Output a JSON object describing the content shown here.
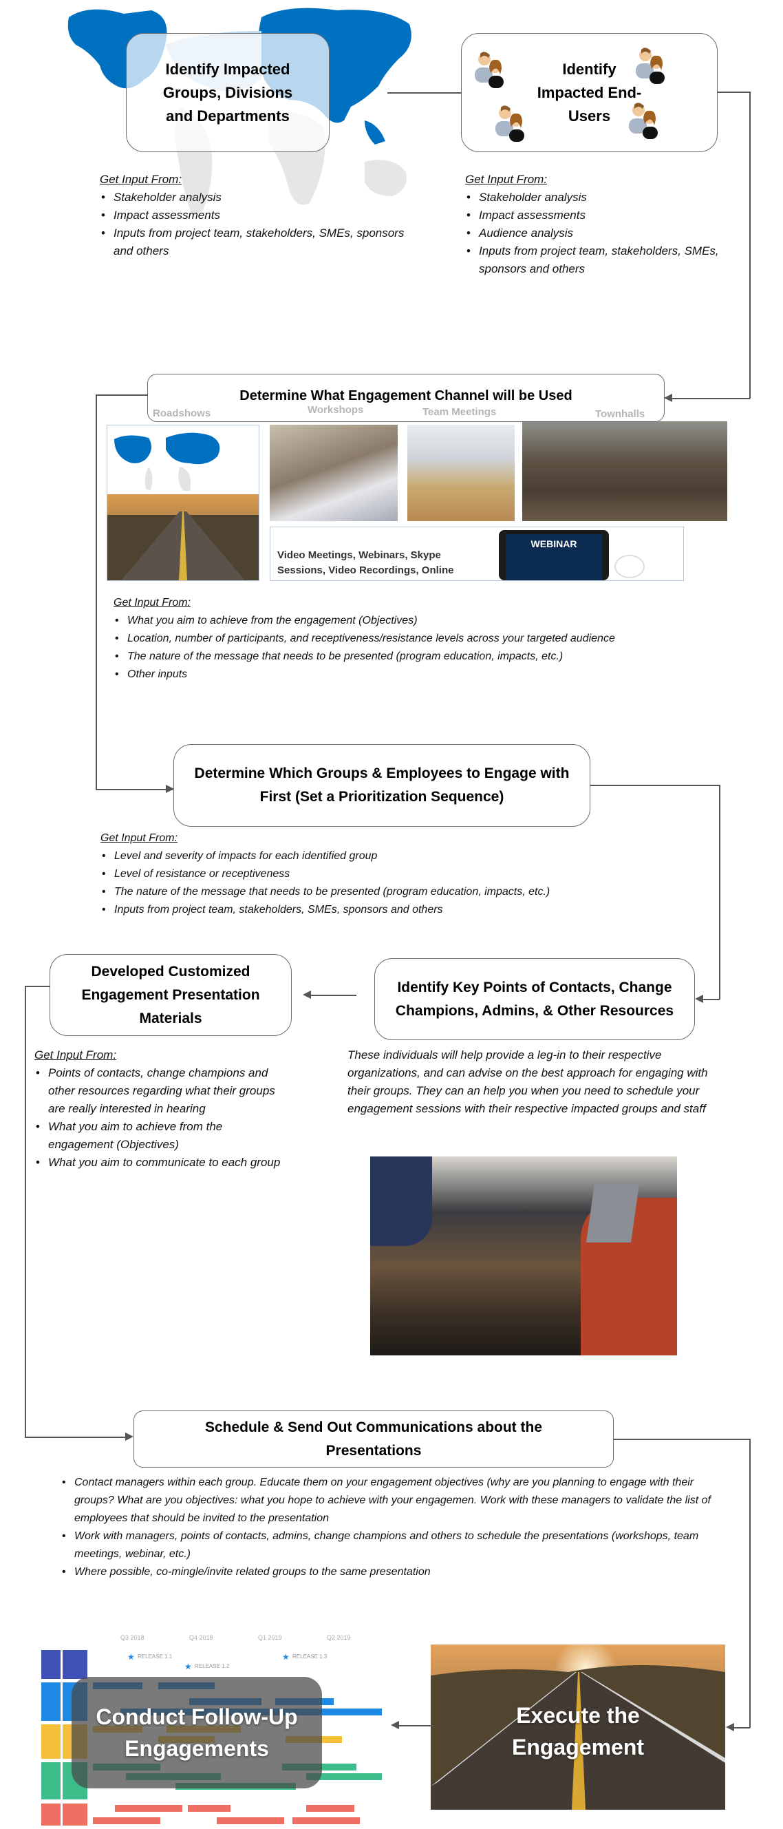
{
  "common": {
    "get_input_from": "Get Input From:"
  },
  "step1": {
    "title": "Identify Impacted Groups, Divisions and Departments",
    "inputs": [
      "Stakeholder analysis",
      "Impact assessments",
      "Inputs from project team, stakeholders, SMEs, sponsors and others"
    ]
  },
  "step2": {
    "title": "Identify Impacted End-Users",
    "inputs": [
      "Stakeholder analysis",
      "Impact assessments",
      "Audience analysis",
      "Inputs from project team, stakeholders, SMEs, sponsors and others"
    ]
  },
  "step3": {
    "title": "Determine What Engagement Channel will be Used",
    "channels": [
      "Roadshows",
      "Workshops",
      "Team Meetings",
      "Townhalls"
    ],
    "virtual_caption": "Video Meetings, Webinars, Skype Sessions, Video Recordings, Online",
    "webinar_label": "WEBINAR",
    "inputs": [
      "What you aim to achieve from the engagement (Objectives)",
      "Location, number of participants,  and receptiveness/resistance  levels across your targeted audience",
      "The nature of the message that needs to be presented (program education, impacts, etc.)",
      "Other inputs"
    ]
  },
  "step4": {
    "title": "Determine Which Groups & Employees to Engage with First (Set a Prioritization Sequence)",
    "inputs": [
      "Level and severity of impacts for each identified group",
      "Level of resistance or receptiveness",
      "The nature of the message that needs to be presented (program education, impacts, etc.)",
      "Inputs from project team, stakeholders, SMEs, sponsors and others"
    ]
  },
  "step5": {
    "title": "Identify Key Points of Contacts, Change Champions, Admins, & Other Resources",
    "description": "These individuals will help provide a leg-in to their respective organizations, and can advise on the best approach for engaging with their groups. They can an help you when you need to schedule your engagement sessions with their respective impacted groups and staff"
  },
  "step6": {
    "title": "Developed Customized Engagement Presentation Materials",
    "inputs": [
      "Points of contacts, change champions and other resources regarding what their groups are really interested in hearing",
      "What you aim to achieve from the engagement (Objectives)",
      "What you aim to communicate to each group"
    ]
  },
  "step7": {
    "title": "Schedule & Send Out Communications about the Presentations",
    "bullets": [
      "Contact managers within each group. Educate them on your engagement objectives (why are you planning to engage with their groups? What are you objectives: what you hope to achieve with your engagemen. Work with these managers to validate the list of employees that should be invited to the presentation",
      "Work with managers, points of contacts, admins, change champions and others to schedule the presentations (workshops, team meetings, webinar, etc.)",
      "Where possible, co-mingle/invite related groups to the same presentation"
    ]
  },
  "step8": {
    "title": "Execute the Engagement"
  },
  "step9": {
    "title": "Conduct Follow-Up Engagements",
    "roadmap_quarters": [
      "Q3 2018",
      "Q4 2018",
      "Q1 2019",
      "Q2 2019"
    ],
    "roadmap_milestones": [
      "RELEASE 1.1",
      "RELEASE 1.2",
      "RELEASE 1.3"
    ]
  },
  "colors": {
    "map_blue": "#0070c0",
    "connector": "#555555"
  }
}
